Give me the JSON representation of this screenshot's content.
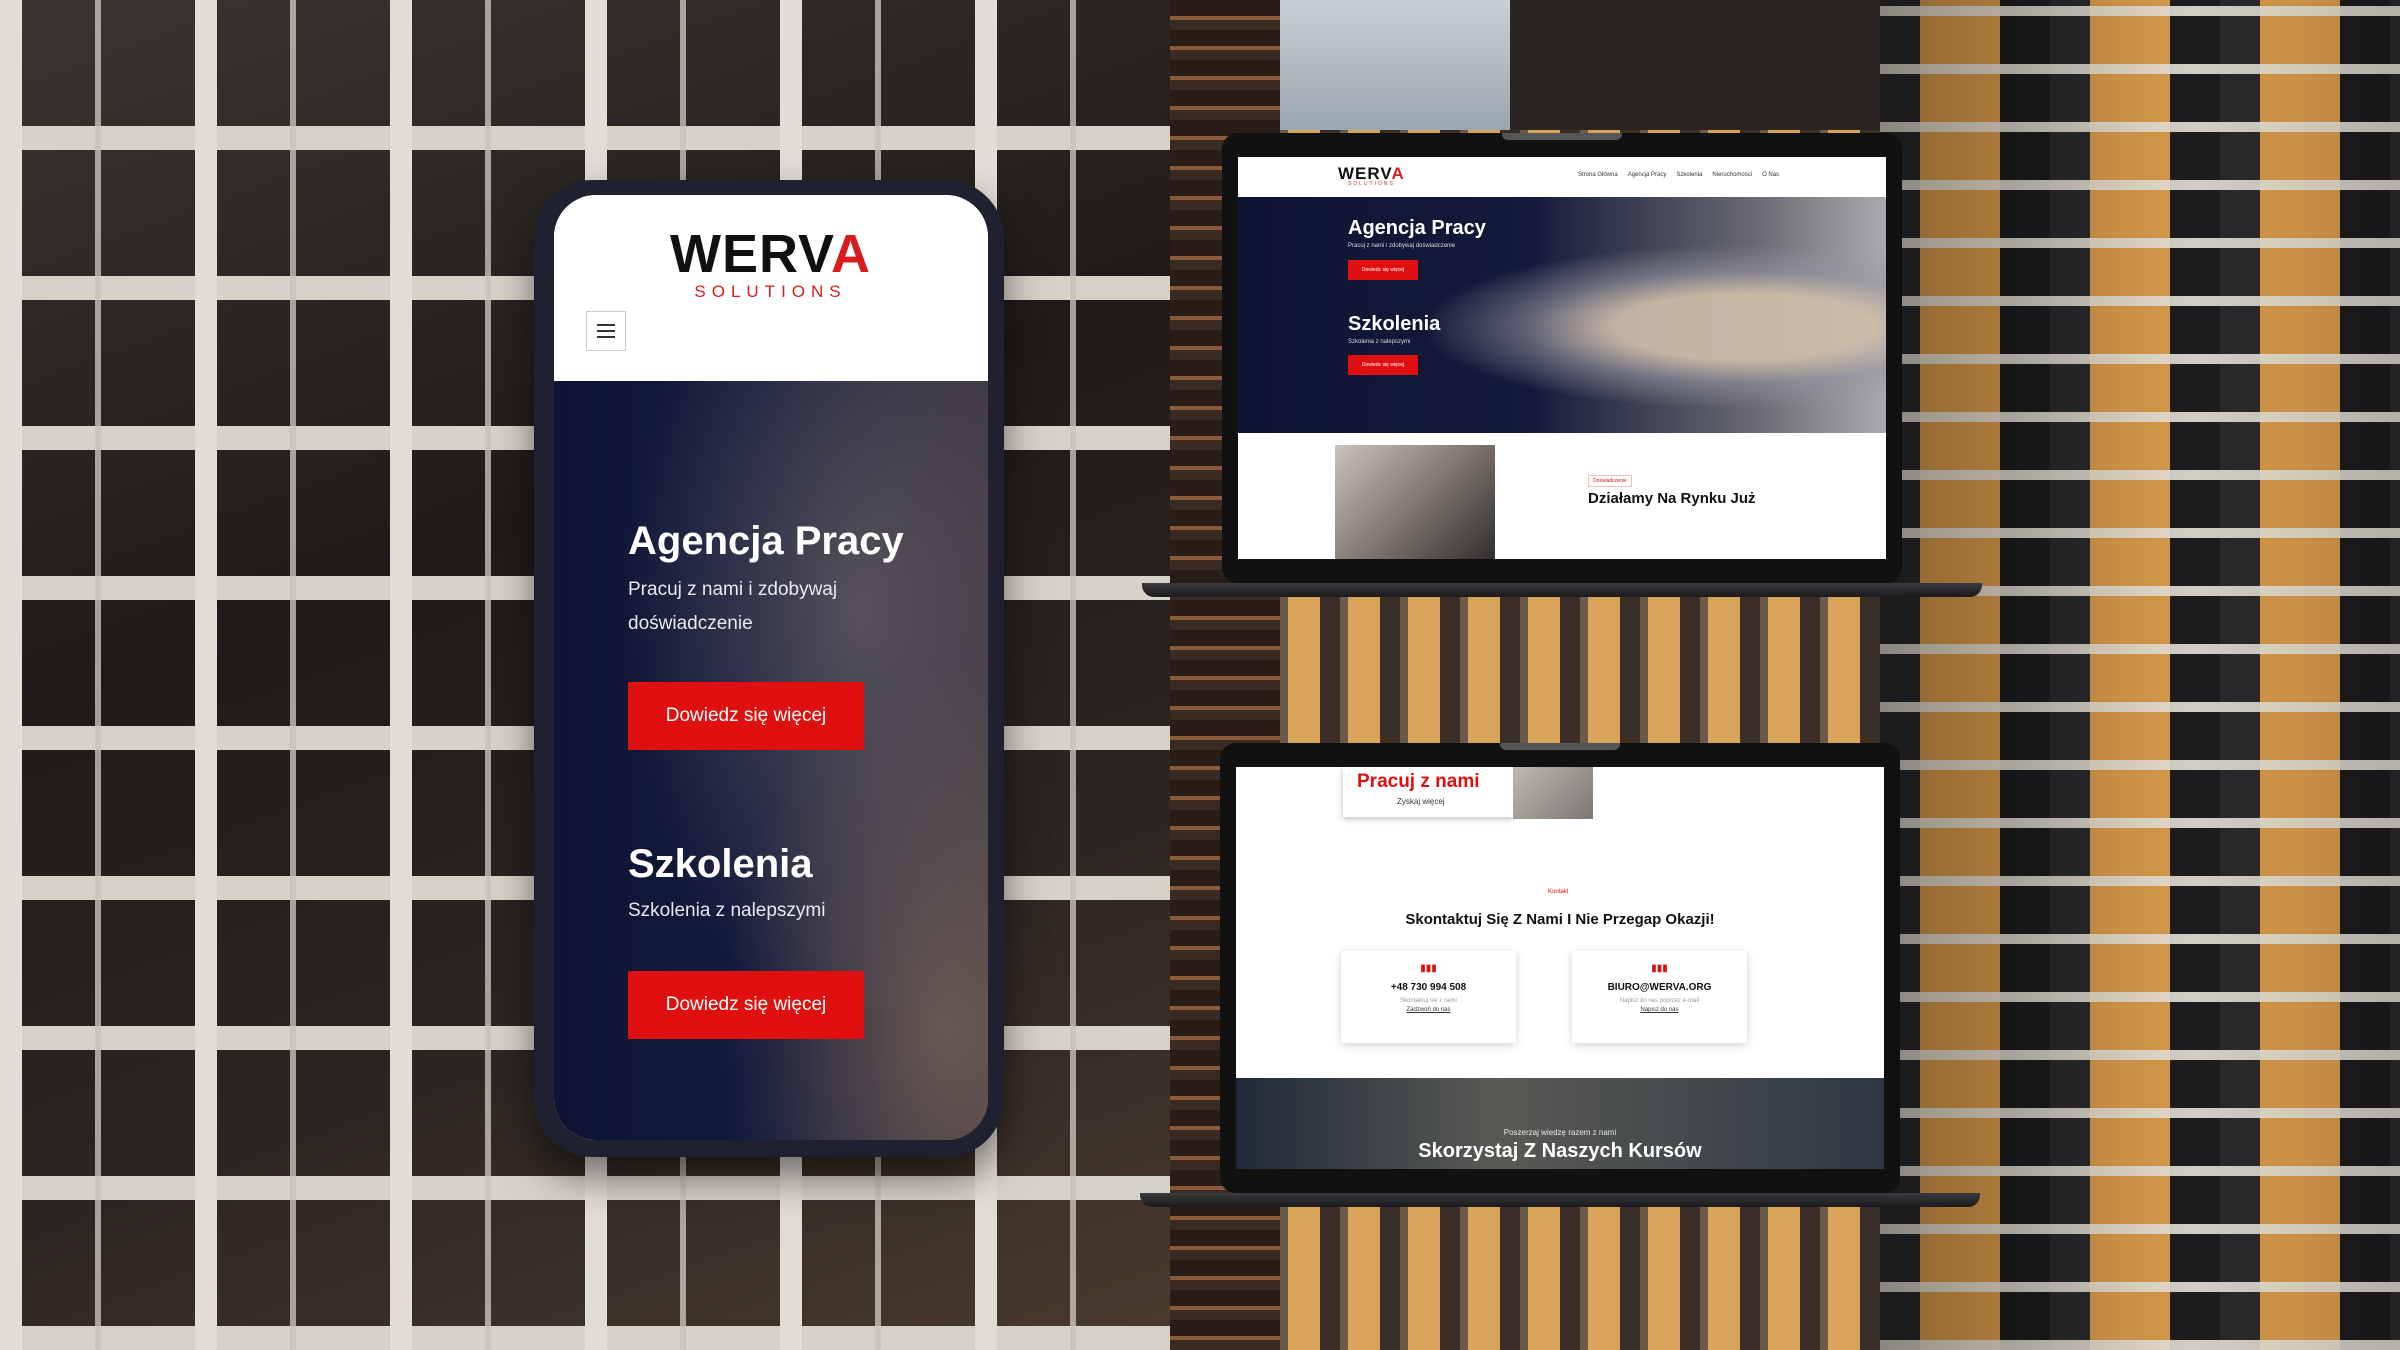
{
  "brand": {
    "logo_main_pre": "WERV",
    "logo_main_accent": "A",
    "logo_sub": "SOLUTIONS"
  },
  "phone": {
    "hero_title_1": "Agencja Pracy",
    "hero_text_1": "Pracuj z nami i zdobywaj doświadczenie",
    "button_1": "Dowiedz się więcej",
    "hero_title_2": "Szkolenia",
    "hero_text_2": "Szkolenia z nalepszymi",
    "button_2": "Dowiedz się więcej"
  },
  "laptop1": {
    "nav": [
      "Strona Główna",
      "Agencja Pracy",
      "Szkolenia",
      "Nieruchomości",
      "O Nas"
    ],
    "hero_title_1": "Agencja Pracy",
    "hero_text_1": "Pracuj z nami i zdobywaj doświadczenie",
    "button_1": "Dowiedz się więcej",
    "hero_title_2": "Szkolenia",
    "hero_text_2": "Szkolenia z nalepszymi",
    "button_2": "Dowiedz się więcej",
    "about_badge": "Doświadczenie",
    "about_heading": "Działamy Na Rynku Już"
  },
  "laptop2": {
    "card_title": "Pracuj z nami",
    "card_sub": "Zyskaj więcej",
    "contact_badge": "Kontakt",
    "contact_heading": "Skontaktuj Się Z Nami I Nie Przegap Okazji!",
    "contacts": [
      {
        "icon": "chart-icon",
        "value": "+48 730 994 508",
        "line1": "Skontaktuj się z nami",
        "line2": "Zadzwoń do nas"
      },
      {
        "icon": "chart-icon",
        "value": "BIURO@WERVA.ORG",
        "line1": "Napisz do nas poprzez e-mail",
        "line2": "Napisz do nas"
      }
    ],
    "footer_sub": "Poszerzaj wiedzę razem z nami",
    "footer_title": "Skorzystaj Z Naszych Kursów"
  },
  "colors": {
    "accent": "#e01010",
    "hero_navy": "#0d1434"
  }
}
